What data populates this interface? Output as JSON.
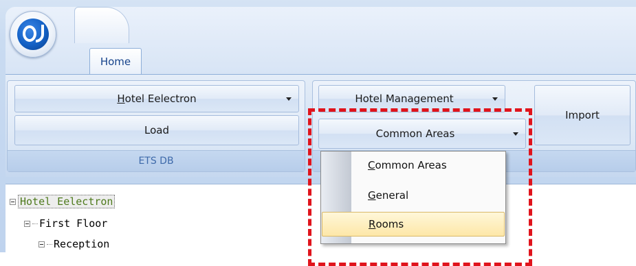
{
  "home_tab": {
    "label": "Home"
  },
  "ets_group": {
    "title": "ETS DB",
    "hotel_dropdown": {
      "label_first": "H",
      "label_rest": "otel Eelectron"
    },
    "load_label": "Load"
  },
  "mgmt_group": {
    "hotel_management_label": "Hotel Management",
    "common_areas_label": "Common Areas",
    "import_label": "Import"
  },
  "dropdown_menu": {
    "items": [
      {
        "first": "C",
        "rest": "ommon Areas"
      },
      {
        "first": "G",
        "rest": "eneral"
      },
      {
        "first": "R",
        "rest": "ooms",
        "highlighted": true
      }
    ]
  },
  "tree": {
    "nodes": [
      "Hotel Eelectron",
      "First Floor",
      "Reception"
    ]
  },
  "colors": {
    "accent": "#15428b",
    "callout": "#e0141c",
    "highlight": "#fde7a8"
  }
}
